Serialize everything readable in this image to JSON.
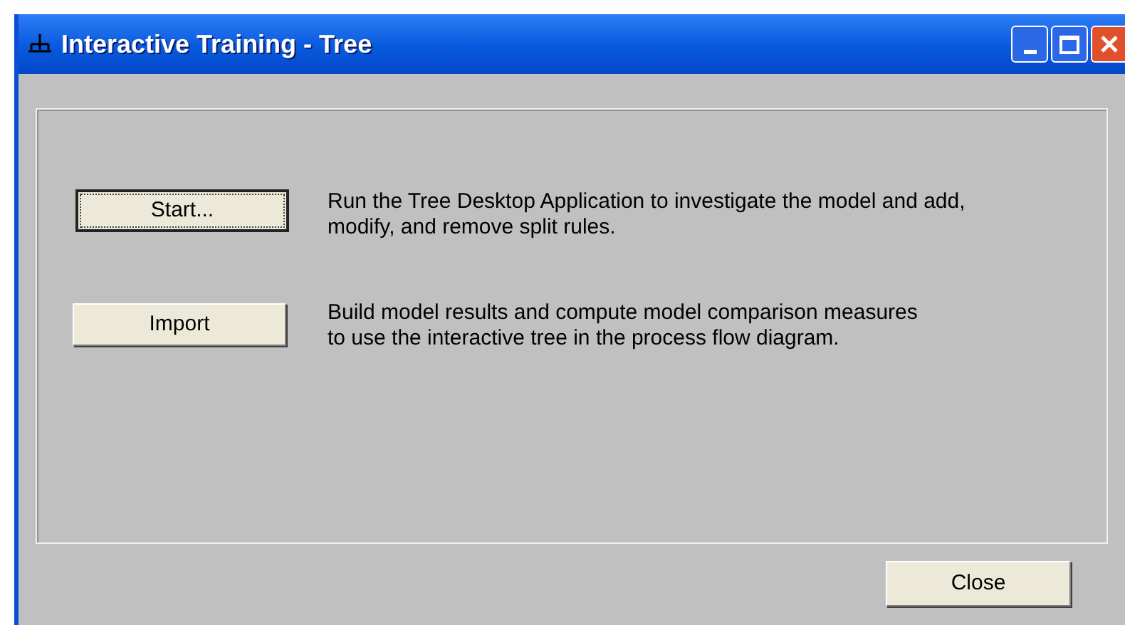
{
  "window": {
    "title": "Interactive Training - Tree"
  },
  "actions": [
    {
      "button": "Start...",
      "focused": true,
      "description": [
        "Run the Tree Desktop Application to investigate the model and add,",
        "modify, and remove split rules."
      ]
    },
    {
      "button": "Import",
      "focused": false,
      "description": [
        "Build model results and compute model comparison measures",
        "to use the interactive tree in the process flow diagram."
      ]
    }
  ],
  "footer_buttons": [
    {
      "label": "Close",
      "focused": false
    }
  ]
}
